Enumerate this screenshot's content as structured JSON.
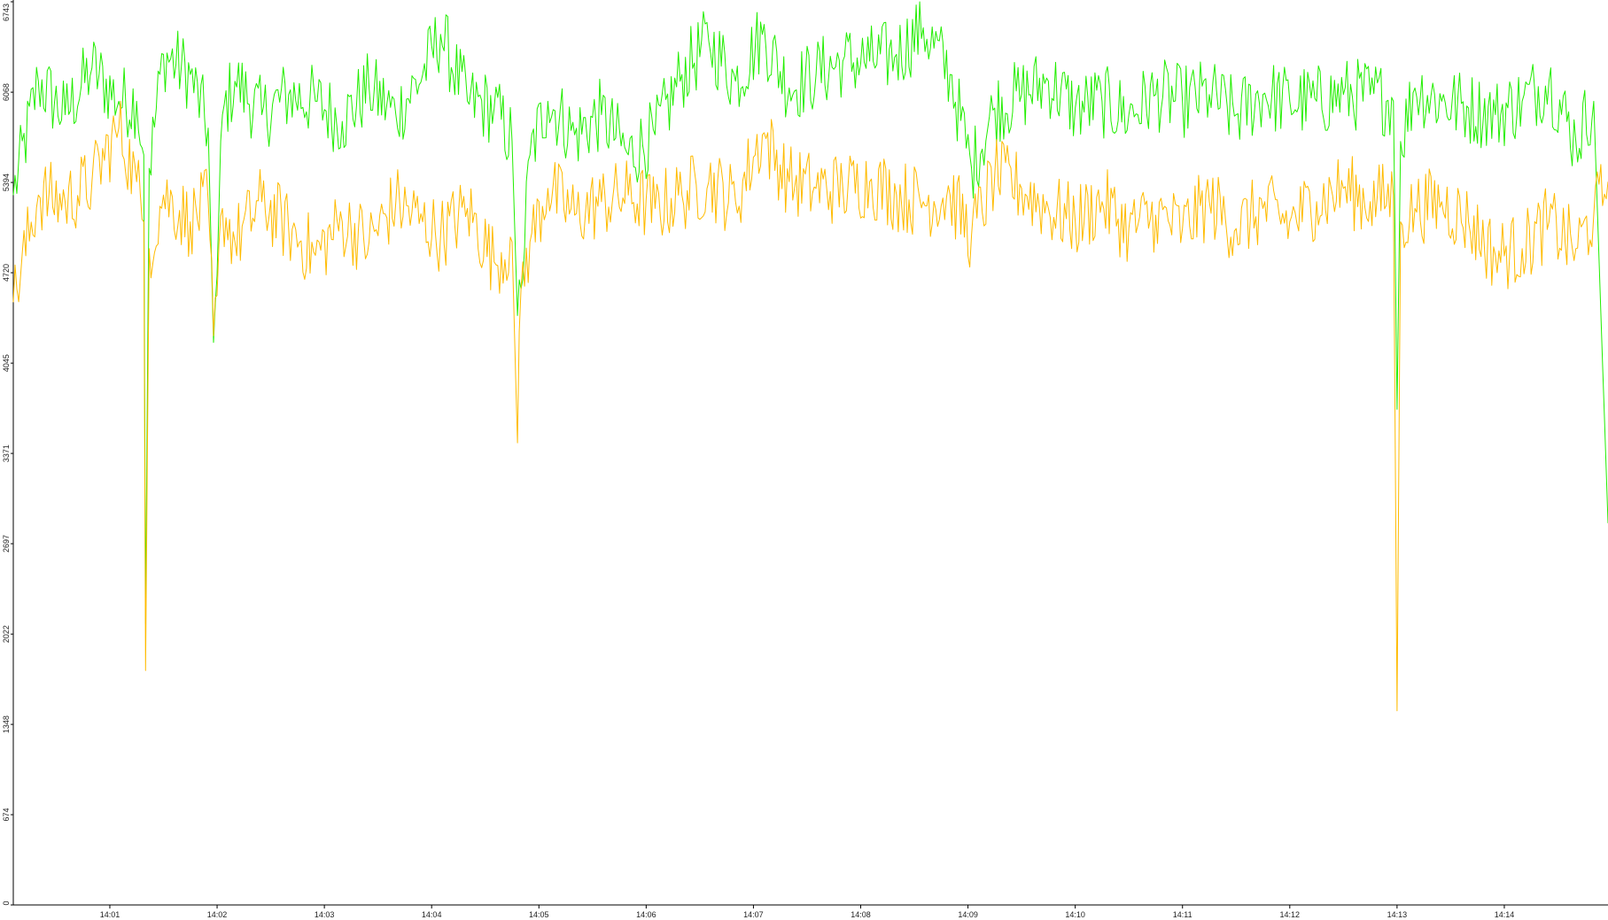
{
  "chart_data": {
    "type": "line",
    "title": "",
    "xlabel": "",
    "ylabel": "",
    "grid": false,
    "legend": "none",
    "ylim": [
      0,
      6743
    ],
    "xlim": [
      "14:00:06",
      "14:14:58"
    ],
    "y_ticks": [
      "0",
      "674",
      "1348",
      "2022",
      "2697",
      "3371",
      "4045",
      "4720",
      "5394",
      "6068",
      "6743"
    ],
    "x_ticks": [
      "14:01",
      "14:02",
      "14:03",
      "14:04",
      "14:05",
      "14:06",
      "14:07",
      "14:08",
      "14:09",
      "14:10",
      "14:11",
      "14:12",
      "14:13",
      "14:14"
    ],
    "series": [
      {
        "color": "#22ee00",
        "x": [
          "14:00:06",
          "14:00:20",
          "14:00:35",
          "14:00:50",
          "14:01:05",
          "14:01:15",
          "14:01:19",
          "14:01:20",
          "14:01:22",
          "14:01:30",
          "14:01:45",
          "14:01:55",
          "14:01:58",
          "14:02:00",
          "14:02:03",
          "14:02:10",
          "14:02:25",
          "14:02:40",
          "14:02:55",
          "14:03:10",
          "14:03:25",
          "14:03:40",
          "14:03:55",
          "14:04:05",
          "14:04:20",
          "14:04:35",
          "14:04:45",
          "14:04:48",
          "14:04:50",
          "14:04:55",
          "14:05:05",
          "14:05:20",
          "14:05:35",
          "14:05:50",
          "14:06:05",
          "14:06:20",
          "14:06:35",
          "14:06:50",
          "14:07:05",
          "14:07:20",
          "14:07:35",
          "14:07:50",
          "14:08:05",
          "14:08:20",
          "14:08:35",
          "14:08:50",
          "14:09:02",
          "14:09:15",
          "14:09:30",
          "14:09:45",
          "14:10:00",
          "14:10:15",
          "14:10:30",
          "14:10:45",
          "14:11:00",
          "14:11:15",
          "14:11:30",
          "14:11:45",
          "14:12:00",
          "14:12:15",
          "14:12:30",
          "14:12:45",
          "14:12:58",
          "14:13:00",
          "14:13:02",
          "14:13:10",
          "14:13:25",
          "14:13:40",
          "14:13:55",
          "14:14:10",
          "14:14:25",
          "14:14:40",
          "14:14:50",
          "14:14:58"
        ],
        "values": [
          5300,
          6150,
          5900,
          6250,
          6000,
          6000,
          5600,
          2100,
          5500,
          6350,
          6200,
          5800,
          4200,
          4700,
          5900,
          6150,
          5900,
          6050,
          6000,
          5850,
          6100,
          5900,
          6200,
          6500,
          6000,
          5950,
          5700,
          4400,
          4600,
          5600,
          6000,
          5750,
          5900,
          5600,
          5750,
          6200,
          6450,
          6150,
          6500,
          6100,
          6200,
          6300,
          6300,
          6350,
          6550,
          6200,
          5500,
          5950,
          6050,
          6150,
          5950,
          6000,
          5900,
          6050,
          6000,
          6050,
          5900,
          6050,
          6000,
          6000,
          6050,
          6050,
          6000,
          3700,
          5700,
          6100,
          6000,
          5950,
          5900,
          6000,
          6150,
          5700,
          6000,
          2850
        ]
      },
      {
        "color": "#ffbb00",
        "x": [
          "14:00:06",
          "14:00:20",
          "14:00:35",
          "14:00:50",
          "14:01:05",
          "14:01:15",
          "14:01:19",
          "14:01:20",
          "14:01:22",
          "14:01:30",
          "14:01:45",
          "14:01:55",
          "14:01:58",
          "14:02:00",
          "14:02:03",
          "14:02:10",
          "14:02:25",
          "14:02:40",
          "14:02:55",
          "14:03:10",
          "14:03:25",
          "14:03:40",
          "14:03:55",
          "14:04:05",
          "14:04:20",
          "14:04:35",
          "14:04:45",
          "14:04:48",
          "14:04:50",
          "14:04:55",
          "14:05:05",
          "14:05:20",
          "14:05:35",
          "14:05:50",
          "14:06:05",
          "14:06:20",
          "14:06:35",
          "14:06:50",
          "14:07:05",
          "14:07:20",
          "14:07:35",
          "14:07:50",
          "14:08:05",
          "14:08:20",
          "14:08:35",
          "14:08:50",
          "14:09:02",
          "14:09:15",
          "14:09:30",
          "14:09:45",
          "14:10:00",
          "14:10:15",
          "14:10:30",
          "14:10:45",
          "14:11:00",
          "14:11:15",
          "14:11:30",
          "14:11:45",
          "14:12:00",
          "14:12:15",
          "14:12:30",
          "14:12:45",
          "14:12:58",
          "14:13:00",
          "14:13:02",
          "14:13:10",
          "14:13:25",
          "14:13:40",
          "14:13:55",
          "14:14:10",
          "14:14:25",
          "14:14:40",
          "14:14:50",
          "14:14:58"
        ],
        "values": [
          4500,
          5300,
          5250,
          5400,
          5800,
          5400,
          5100,
          1750,
          4900,
          5300,
          5100,
          5250,
          4250,
          4550,
          5200,
          4950,
          5250,
          5050,
          4850,
          5100,
          4950,
          5250,
          5100,
          5000,
          5200,
          4800,
          4950,
          3450,
          4600,
          4950,
          5350,
          5150,
          5250,
          5300,
          5200,
          5300,
          5400,
          5250,
          5750,
          5400,
          5350,
          5350,
          5400,
          5300,
          5250,
          5300,
          5000,
          5450,
          5350,
          5200,
          5100,
          5250,
          5050,
          5150,
          5050,
          5250,
          5050,
          5200,
          5100,
          5250,
          5350,
          5250,
          5300,
          1450,
          5100,
          5200,
          5250,
          5100,
          4850,
          4900,
          5100,
          4900,
          5150,
          5400
        ]
      }
    ]
  }
}
